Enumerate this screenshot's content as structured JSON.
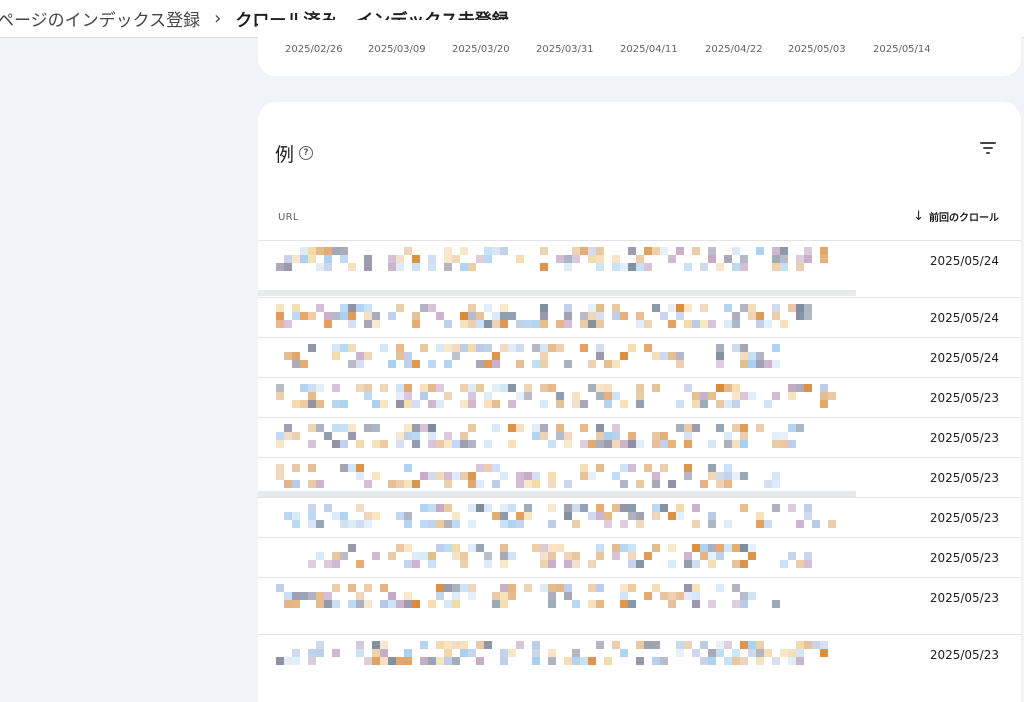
{
  "breadcrumb": {
    "first": "ページのインデックス登録",
    "separator": "›",
    "current": "クロール済み - インデックス未登録"
  },
  "chart": {
    "x_ticks": [
      "2025/02/26",
      "2025/03/09",
      "2025/03/20",
      "2025/03/31",
      "2025/04/11",
      "2025/04/22",
      "2025/05/03",
      "2025/05/14"
    ]
  },
  "examples": {
    "title": "例",
    "help_icon": "help-circle-icon",
    "filter_icon": "filter-icon",
    "col_url": "URL",
    "col_last_crawl": "前回のクロール",
    "sort_icon": "arrow-down-icon",
    "rows": [
      {
        "date": "2025/05/24"
      },
      {
        "date": "2025/05/24"
      },
      {
        "date": "2025/05/24"
      },
      {
        "date": "2025/05/23"
      },
      {
        "date": "2025/05/23"
      },
      {
        "date": "2025/05/23"
      },
      {
        "date": "2025/05/23"
      },
      {
        "date": "2025/05/23"
      },
      {
        "date": "2025/05/23"
      },
      {
        "date": "2025/05/23"
      }
    ]
  },
  "colors": {
    "background": "#f1f3f8",
    "card": "#ffffff",
    "pixelation": [
      "#a9cff0",
      "#e3b98a",
      "#8f8fa3",
      "#c5a8c6",
      "#f3d9a8",
      "#d4e6f6",
      "#7b8a9c",
      "#d88a3c",
      "#b8c9e6",
      "#eac7a0"
    ]
  }
}
